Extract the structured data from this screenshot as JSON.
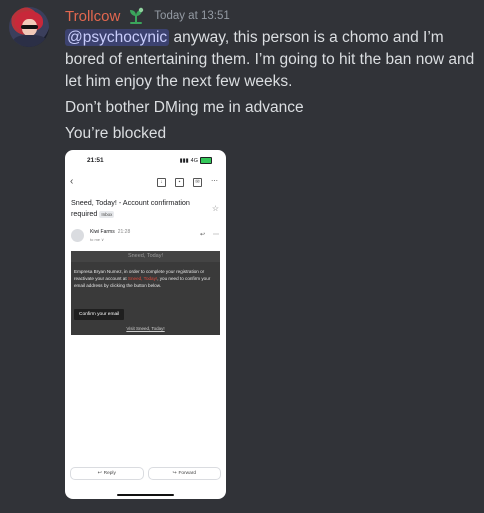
{
  "message": {
    "author": "Trollcow",
    "timestamp": "Today at 13:51",
    "mention": "@psychocynic",
    "text_line1_rest": " anyway, this person is a chomo and I’m bored of entertaining them. I’m going to hit the ban now and let him enjoy the next few weeks.",
    "text_line2": "Don’t bother DMing me in advance",
    "text_line3": "You’re blocked"
  },
  "colors": {
    "background": "#313338",
    "username": "#e2674f",
    "mention_bg": "#3c4270",
    "role_icon": "#3ba55c"
  },
  "icons": {
    "role": "sprout-role-icon",
    "back": "arrow-left-icon",
    "star": "star-icon"
  },
  "attachment": {
    "status_time": "21:51",
    "status_signal": "4G",
    "subject": "Sneed, Today! - Account confirmation required",
    "inbox_label": "Inbox",
    "sender": "Kiwi Farms",
    "sender_time": "21:28",
    "sender_to": "to me ∨",
    "email_title": "Sneed, Today!",
    "email_body_before": "Empresa Bryan Numez, in order to complete your registration or reactivate your account at ",
    "email_body_link": "Sneed, Today!",
    "email_body_after": ", you need to confirm your email address by clicking the button below.",
    "confirm_button": "Confirm your email",
    "visit_link": "Visit Sneed, Today!",
    "reply_label": "Reply",
    "forward_label": "Forward"
  }
}
